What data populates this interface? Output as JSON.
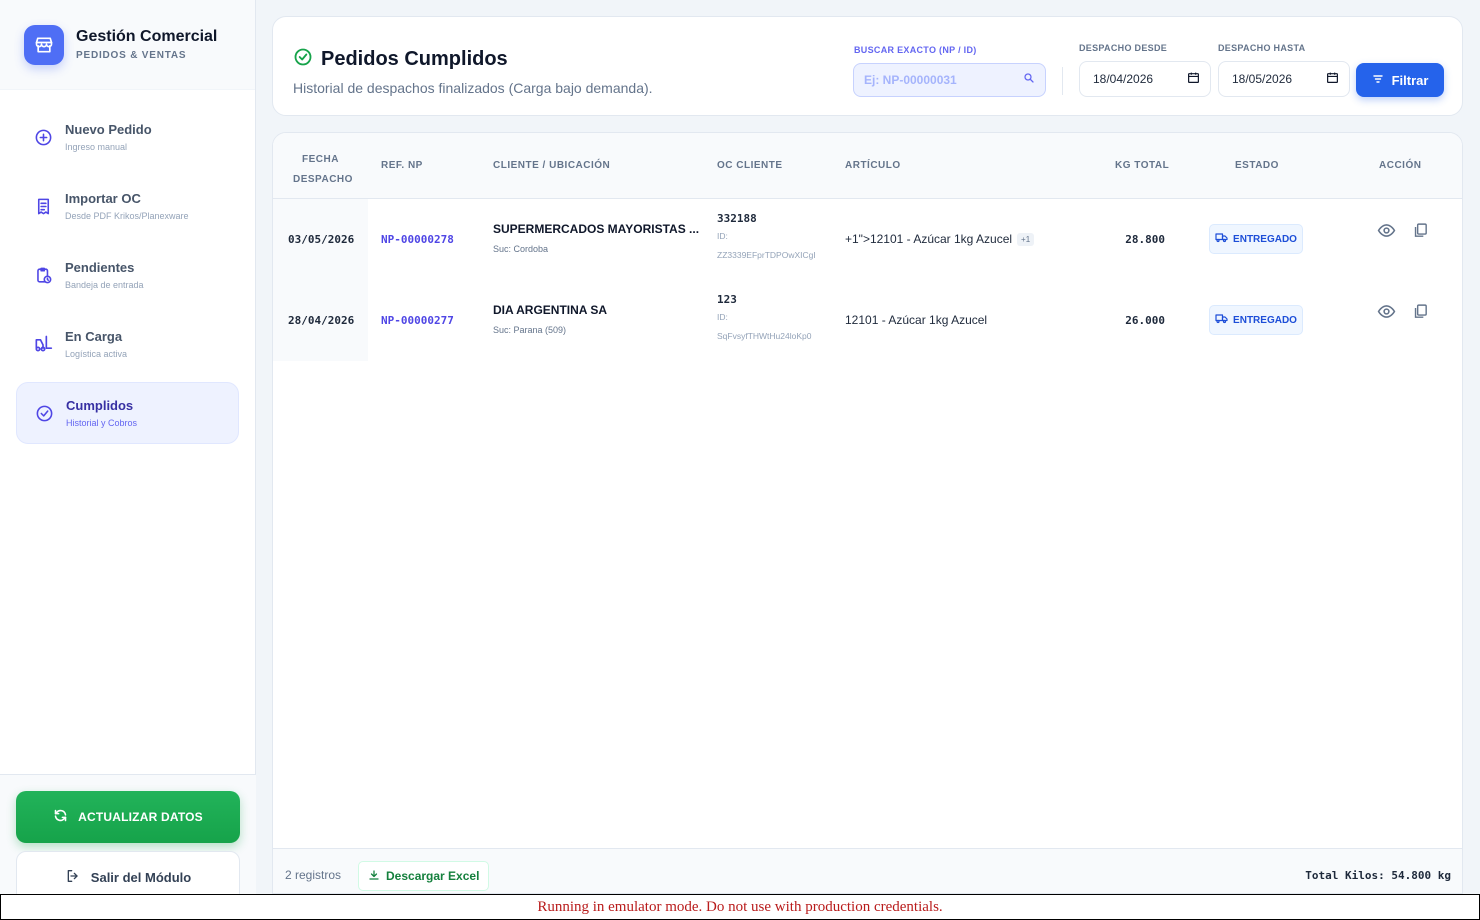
{
  "colors": {
    "brand": "#4f6ef5",
    "active_nav": "#3730a3",
    "success": "#16a34a",
    "primary": "#2563eb",
    "link": "#4f46e5"
  },
  "brand": {
    "title": "Gestión Comercial",
    "subtitle": "PEDIDOS & VENTAS",
    "icon": "store-icon"
  },
  "nav": [
    {
      "label": "Nuevo Pedido",
      "sub": "Ingreso manual",
      "icon": "plus-circle-icon",
      "active": false
    },
    {
      "label": "Importar OC",
      "sub": "Desde PDF Krikos/Planexware",
      "icon": "receipt-icon",
      "active": false
    },
    {
      "label": "Pendientes",
      "sub": "Bandeja de entrada",
      "icon": "clipboard-clock-icon",
      "active": false
    },
    {
      "label": "En Carga",
      "sub": "Logística activa",
      "icon": "forklift-icon",
      "active": false
    },
    {
      "label": "Cumplidos",
      "sub": "Historial y Cobros",
      "icon": "check-circle-icon",
      "active": true
    }
  ],
  "sidebar_actions": {
    "refresh": "ACTUALIZAR DATOS",
    "exit": "Salir del Módulo"
  },
  "header": {
    "title": "Pedidos Cumplidos",
    "description": "Historial de despachos finalizados (Carga bajo demanda).",
    "search_label": "BUSCAR EXACTO (NP / ID)",
    "search_placeholder": "Ej: NP-00000031",
    "from_label": "DESPACHO DESDE",
    "from_value": "18/04/2026",
    "to_label": "DESPACHO HASTA",
    "to_value": "18/05/2026",
    "filter_button": "Filtrar"
  },
  "table": {
    "headers": {
      "fecha_line1": "FECHA",
      "fecha_line2": "DESPACHO",
      "ref": "REF. NP",
      "cliente": "CLIENTE / UBICACIÓN",
      "oc": "OC CLIENTE",
      "articulo": "ARTÍCULO",
      "kg": "KG TOTAL",
      "estado": "ESTADO",
      "accion": "ACCIÓN"
    },
    "rows": [
      {
        "fecha": "03/05/2026",
        "ref": "NP-00000278",
        "cliente": "SUPERMERCADOS MAYORISTAS ...",
        "sucursal": "Suc: Cordoba",
        "oc": "332188",
        "oc_id_label": "ID:",
        "oc_id": "ZZ3339EFprTDPOwXICgI",
        "articulo": "+1\">12101 - Azúcar 1kg Azucel",
        "articulo_extra": "+1",
        "kg": "28.800",
        "estado": "ENTREGADO"
      },
      {
        "fecha": "28/04/2026",
        "ref": "NP-00000277",
        "cliente": "DIA ARGENTINA SA",
        "sucursal": "Suc: Parana (509)",
        "oc": "123",
        "oc_id_label": "ID:",
        "oc_id": "SqFvsyfTHWtHu24loKp0",
        "articulo": "12101 - Azúcar 1kg Azucel",
        "articulo_extra": "",
        "kg": "26.000",
        "estado": "ENTREGADO"
      }
    ]
  },
  "footer": {
    "count": "2 registros",
    "excel": "Descargar Excel",
    "total": "Total Kilos: 54.800 kg"
  },
  "banner": "Running in emulator mode. Do not use with production credentials."
}
